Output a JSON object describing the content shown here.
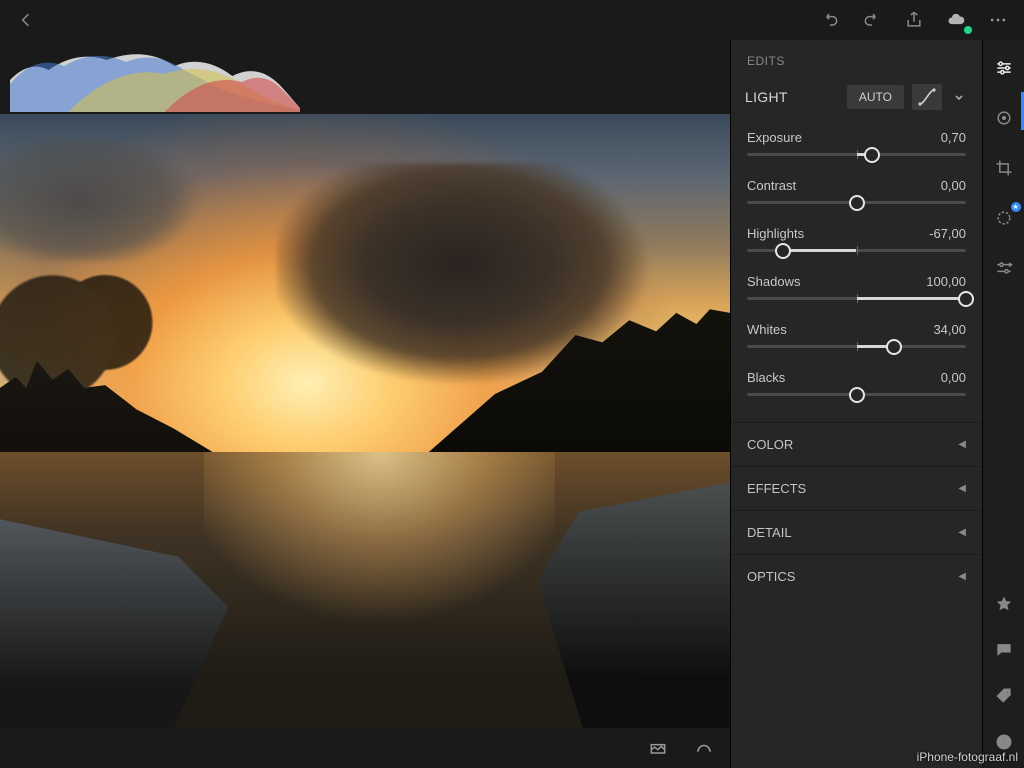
{
  "panel": {
    "header": "EDITS",
    "light_title": "LIGHT",
    "auto_label": "AUTO",
    "sliders": [
      {
        "label": "Exposure",
        "value_text": "0,70",
        "value": 0.7,
        "min": -5,
        "max": 5
      },
      {
        "label": "Contrast",
        "value_text": "0,00",
        "value": 0,
        "min": -100,
        "max": 100
      },
      {
        "label": "Highlights",
        "value_text": "-67,00",
        "value": -67,
        "min": -100,
        "max": 100
      },
      {
        "label": "Shadows",
        "value_text": "100,00",
        "value": 100,
        "min": -100,
        "max": 100
      },
      {
        "label": "Whites",
        "value_text": "34,00",
        "value": 34,
        "min": -100,
        "max": 100
      },
      {
        "label": "Blacks",
        "value_text": "0,00",
        "value": 0,
        "min": -100,
        "max": 100
      }
    ],
    "collapsed": [
      "COLOR",
      "EFFECTS",
      "DETAIL",
      "OPTICS"
    ]
  },
  "watermark": "iPhone-fotograaf.nl"
}
